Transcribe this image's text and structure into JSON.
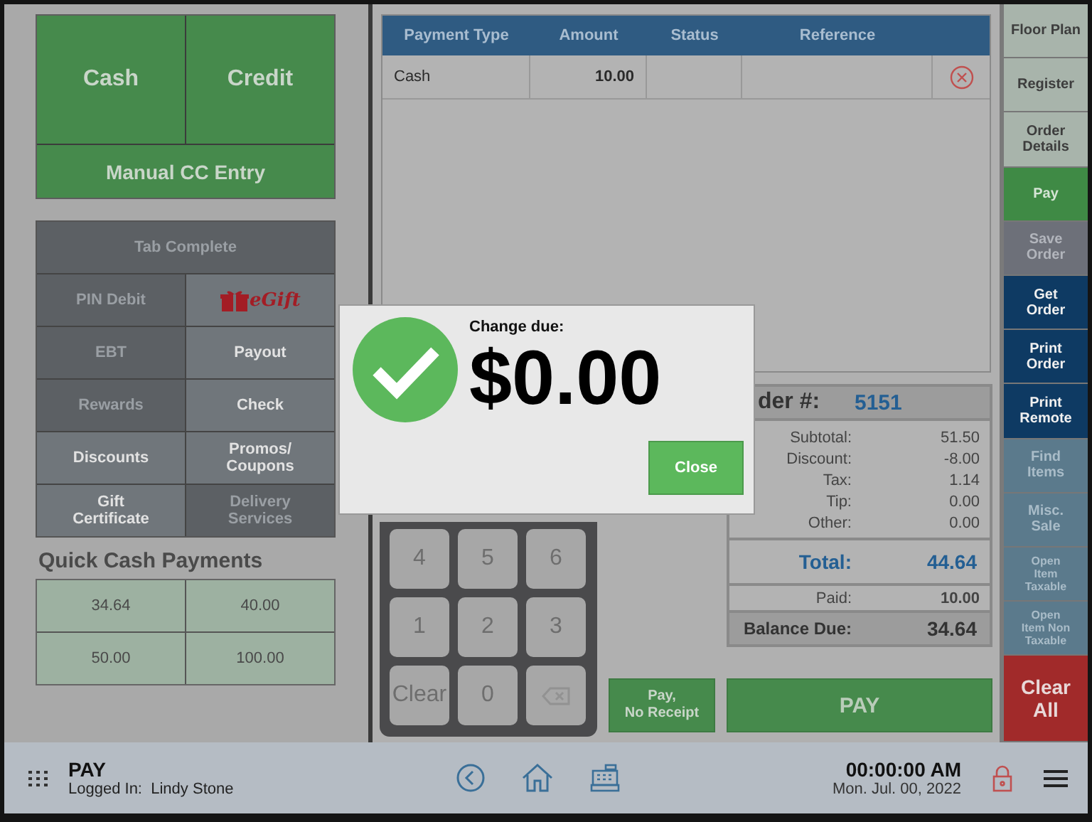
{
  "tender_buttons": {
    "top": [
      {
        "label": "Cash"
      },
      {
        "label": "Credit"
      }
    ],
    "wide": {
      "label": "Manual CC Entry"
    }
  },
  "payment_options": [
    {
      "label": "Tab Complete",
      "disabled": true,
      "kind": "wide"
    },
    {
      "label": "PIN Debit",
      "disabled": true,
      "kind": "text"
    },
    {
      "label": "eGift",
      "disabled": false,
      "kind": "egift"
    },
    {
      "label": "EBT",
      "disabled": true,
      "kind": "text"
    },
    {
      "label": "Payout",
      "disabled": false,
      "kind": "text"
    },
    {
      "label": "Rewards",
      "disabled": true,
      "kind": "text"
    },
    {
      "label": "Check",
      "disabled": false,
      "kind": "text"
    },
    {
      "label": "Discounts",
      "disabled": false,
      "kind": "text"
    },
    {
      "label": "Promos/\nCoupons",
      "disabled": false,
      "kind": "text"
    },
    {
      "label": "Gift\nCertificate",
      "disabled": false,
      "kind": "text"
    },
    {
      "label": "Delivery\nServices",
      "disabled": true,
      "kind": "text"
    }
  ],
  "quick_cash": {
    "title": "Quick Cash Payments",
    "amounts": [
      "34.64",
      "40.00",
      "50.00",
      "100.00"
    ]
  },
  "payments_table": {
    "columns": [
      "Payment Type",
      "Amount",
      "Status",
      "Reference"
    ],
    "rows": [
      {
        "type": "Cash",
        "amount": "10.00"
      }
    ]
  },
  "keypad": [
    {
      "kind": "digit",
      "label": "4"
    },
    {
      "kind": "digit",
      "label": "5"
    },
    {
      "kind": "digit",
      "label": "6"
    },
    {
      "kind": "digit",
      "label": "1"
    },
    {
      "kind": "digit",
      "label": "2"
    },
    {
      "kind": "digit",
      "label": "3"
    },
    {
      "kind": "digit",
      "label": "Clear"
    },
    {
      "kind": "digit",
      "label": "0"
    },
    {
      "kind": "backspace"
    }
  ],
  "order_summary": {
    "order_label": "der #:",
    "order_number": "5151",
    "lines": [
      {
        "label": "Subtotal:",
        "value": "51.50"
      },
      {
        "label": "Discount:",
        "value": "-8.00"
      },
      {
        "label": "Tax:",
        "value": "1.14"
      },
      {
        "label": "Tip:",
        "value": "0.00"
      },
      {
        "label": "Other:",
        "value": "0.00"
      }
    ],
    "total": {
      "label": "Total:",
      "value": "44.64"
    },
    "paid": {
      "label": "Paid:",
      "value": "10.00"
    },
    "balance": {
      "label": "Balance Due:",
      "value": "34.64"
    }
  },
  "pay_no_receipt": "Pay,\nNo Receipt",
  "pay_button": "PAY",
  "dialog": {
    "caption": "Change due:",
    "amount": "$0.00",
    "button": "Close"
  },
  "sidebar": [
    {
      "label": "Floor Plan",
      "kind": "plain",
      "selected": false,
      "disabled": false
    },
    {
      "label": "Register",
      "kind": "plain",
      "selected": false,
      "disabled": false
    },
    {
      "label": "Order\nDetails",
      "kind": "plain",
      "selected": false,
      "disabled": false
    },
    {
      "label": "Pay",
      "kind": "plain",
      "selected": true,
      "disabled": false
    },
    {
      "label": "Save\nOrder",
      "kind": "grey",
      "selected": false,
      "disabled": true
    },
    {
      "label": "Get\nOrder",
      "kind": "navy",
      "selected": false,
      "disabled": false
    },
    {
      "label": "Print\nOrder",
      "kind": "navy",
      "selected": false,
      "disabled": false
    },
    {
      "label": "Print\nRemote",
      "kind": "navy",
      "selected": false,
      "disabled": false
    },
    {
      "label": "Find\nItems",
      "kind": "slate",
      "selected": false,
      "disabled": true
    },
    {
      "label": "Misc.\nSale",
      "kind": "slate",
      "selected": false,
      "disabled": true
    },
    {
      "label": "Open\nItem\nTaxable",
      "kind": "slate",
      "selected": false,
      "disabled": true
    },
    {
      "label": "Open\nItem Non\nTaxable",
      "kind": "slate",
      "selected": false,
      "disabled": true
    },
    {
      "label": "Clear\nAll",
      "kind": "danger",
      "selected": false,
      "disabled": false
    }
  ],
  "status_bar": {
    "screen": "PAY",
    "logged_in_label": "Logged In:",
    "user": "Lindy Stone",
    "time": "00:00:00 AM",
    "date": "Mon. Jul. 00, 2022"
  }
}
